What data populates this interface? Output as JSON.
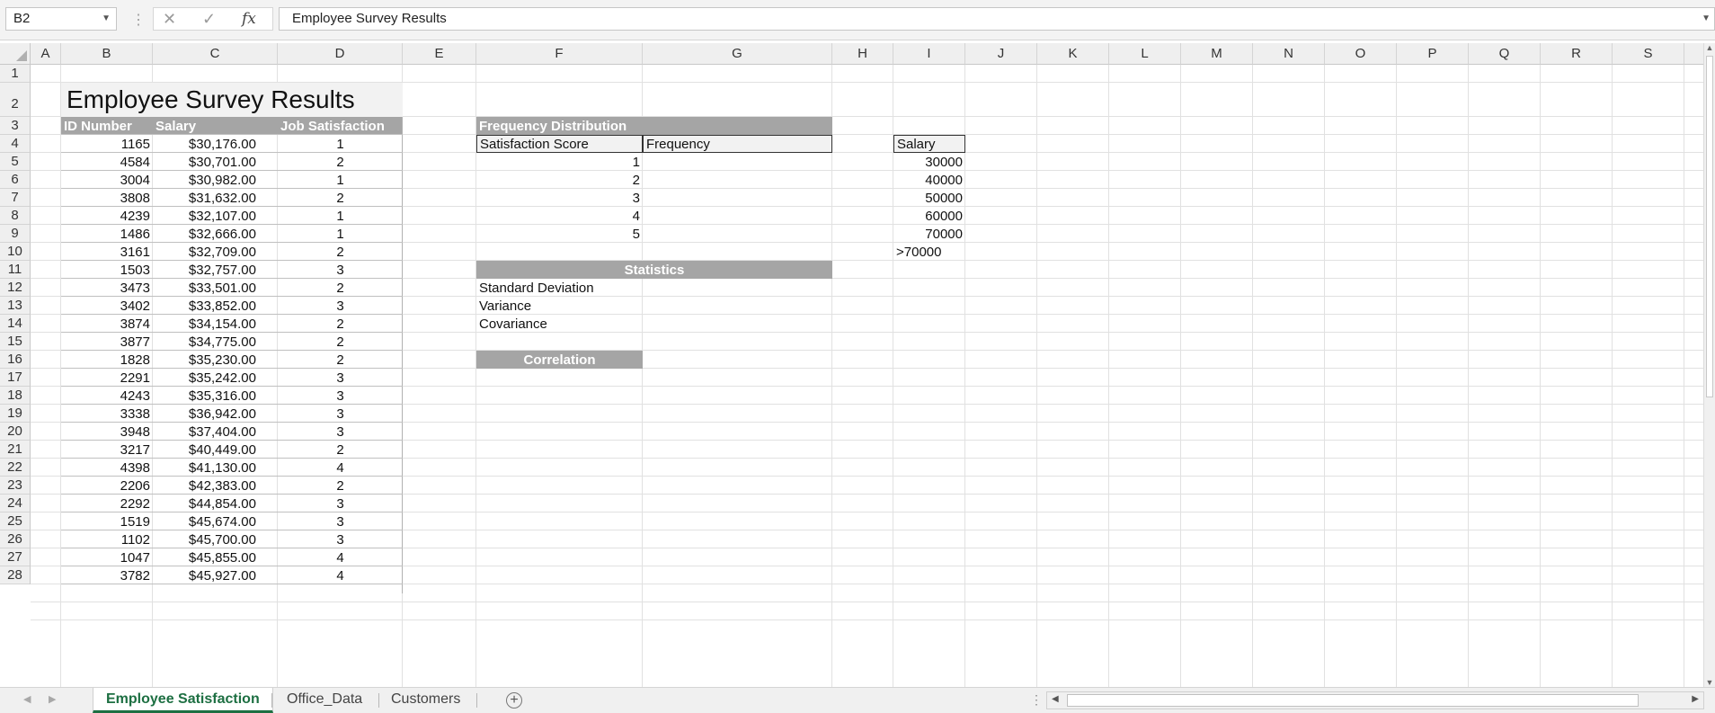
{
  "formula_bar": {
    "name_box": "B2",
    "cancel_icon": "close-icon",
    "enter_icon": "check-icon",
    "fx_label": "fx",
    "content": "Employee Survey Results"
  },
  "columns": [
    "A",
    "B",
    "C",
    "D",
    "E",
    "F",
    "G",
    "H",
    "I",
    "J",
    "K",
    "L",
    "M",
    "N",
    "O",
    "P",
    "Q",
    "R",
    "S"
  ],
  "rows": [
    "1",
    "2",
    "3",
    "4",
    "5",
    "6",
    "7",
    "8",
    "9",
    "10",
    "11",
    "12",
    "13",
    "14",
    "15",
    "16",
    "17",
    "18",
    "19",
    "20",
    "21",
    "22",
    "23",
    "24",
    "25",
    "26",
    "27",
    "28"
  ],
  "title": "Employee Survey Results",
  "table": {
    "headers": [
      "ID Number",
      "Salary",
      "Job Satisfaction"
    ],
    "rows": [
      [
        "1165",
        "$30,176.00",
        "1"
      ],
      [
        "4584",
        "$30,701.00",
        "2"
      ],
      [
        "3004",
        "$30,982.00",
        "1"
      ],
      [
        "3808",
        "$31,632.00",
        "2"
      ],
      [
        "4239",
        "$32,107.00",
        "1"
      ],
      [
        "1486",
        "$32,666.00",
        "1"
      ],
      [
        "3161",
        "$32,709.00",
        "2"
      ],
      [
        "1503",
        "$32,757.00",
        "3"
      ],
      [
        "3473",
        "$33,501.00",
        "2"
      ],
      [
        "3402",
        "$33,852.00",
        "3"
      ],
      [
        "3874",
        "$34,154.00",
        "2"
      ],
      [
        "3877",
        "$34,775.00",
        "2"
      ],
      [
        "1828",
        "$35,230.00",
        "2"
      ],
      [
        "2291",
        "$35,242.00",
        "3"
      ],
      [
        "4243",
        "$35,316.00",
        "3"
      ],
      [
        "3338",
        "$36,942.00",
        "3"
      ],
      [
        "3948",
        "$37,404.00",
        "3"
      ],
      [
        "3217",
        "$40,449.00",
        "2"
      ],
      [
        "4398",
        "$41,130.00",
        "4"
      ],
      [
        "2206",
        "$42,383.00",
        "2"
      ],
      [
        "2292",
        "$44,854.00",
        "3"
      ],
      [
        "1519",
        "$45,674.00",
        "3"
      ],
      [
        "1102",
        "$45,700.00",
        "3"
      ],
      [
        "1047",
        "$45,855.00",
        "4"
      ],
      [
        "3782",
        "$45,927.00",
        "4"
      ]
    ]
  },
  "frequency": {
    "title": "Frequency Distribution",
    "col_score": "Satisfaction Score",
    "col_freq": "Frequency",
    "scores": [
      "1",
      "2",
      "3",
      "4",
      "5"
    ]
  },
  "salary_bins": {
    "header": "Salary",
    "bins": [
      "30000",
      "40000",
      "50000",
      "60000",
      "70000",
      ">70000"
    ]
  },
  "statistics": {
    "title": "Statistics",
    "items": [
      "Standard Deviation",
      "Variance",
      "Covariance"
    ]
  },
  "correlation": {
    "title": "Correlation"
  },
  "tabs": [
    "Employee Satisfaction",
    "Office_Data",
    "Customers"
  ],
  "active_tab": "Employee Satisfaction"
}
